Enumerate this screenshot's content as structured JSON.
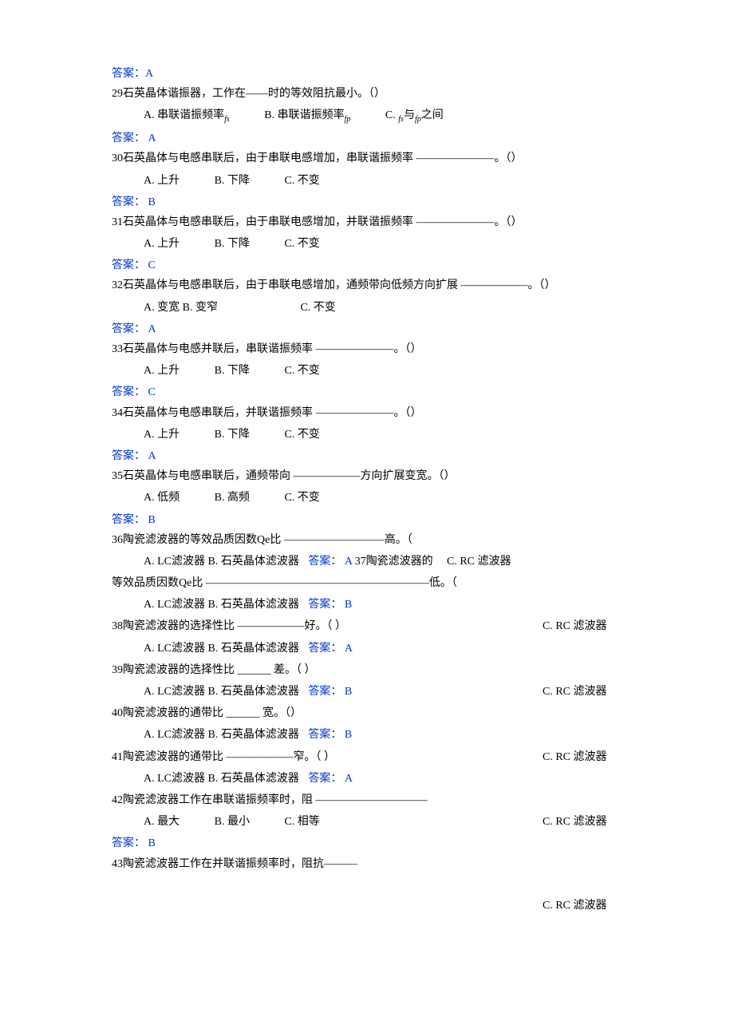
{
  "a28": "答案：A",
  "q29": "29石英晶体谐振器，工作在——时的等效阻抗最小。（）",
  "q29a": "A. 串联谐振频率",
  "q29a_sub": "fs",
  "q29b": "B. 串联谐振频率",
  "q29b_sub": "fp",
  "q29c_pre": "C.  ",
  "q29c_sub1": "fs",
  "q29c_mid": "与",
  "q29c_sub2": "fp",
  "q29c_post": "之间",
  "a29": "答案：  A",
  "q30": "30石英晶体与电感串联后，由于串联电感增加，串联谐振频率 ———————。（）",
  "q30a": "A.  上升",
  "q30b": "B. 下降",
  "q30c": "C. 不变",
  "a30": "答案：  B",
  "q31": "31石英晶体与电感串联后，由于串联电感增加，并联谐振频率 ———————。（）",
  "q31a": "A.  上升",
  "q31b": "B. 下降",
  "q31c": "C. 不变",
  "a31": "答案：  C",
  "q32": "32石英晶体与电感串联后，由于串联电感增加，通频带向低频方向扩展 ——————。（）",
  "q32a": "A. 变宽 B. 变窄",
  "q32c": "C. 不变",
  "a32": "答案：  A",
  "q33": "33石英晶体与电感并联后，串联谐振频率 ———————。（）",
  "q33a": "A.  上升",
  "q33b": "B. 下降",
  "q33c": "C. 不变",
  "a33": "答案：  C",
  "q34": "34石英晶体与电感串联后，并联谐振频率 ———————。（）",
  "q34a": "A.  上升",
  "q34b": "B. 下降",
  "q34c": "C. 不变",
  "a34": "答案：  A",
  "q35": "35石英晶体与电感串联后，通频带向 ——————方向扩展变宽。（）",
  "q35a": "A. 低频",
  "q35b": "B. 高频",
  "q35c": "C. 不变",
  "a35": "答案：  B",
  "q36": "36陶瓷滤波器的等效品质因数Qe比 —————————高。（",
  "q36a": "A.  LC滤波器 B.  石英晶体滤波器",
  "a36": "答案：  A",
  "q37_inline": "37陶瓷滤波器的",
  "q37_overlap": "C.  RC 滤波器",
  "q37_cont": "等效品质因数Qe比 ————————————————————低。（",
  "q37a": "A.  LC滤波器 B.  石英晶体滤波器",
  "a37": "答案：  B",
  "q38": "38陶瓷滤波器的选择性比 ——————好。（ ）",
  "q38c": "C.  RC 滤波器",
  "q38a": "A.  LC滤波器 B.  石英晶体滤波器",
  "a38": "答案：  A",
  "q39": "39陶瓷滤波器的选择性比 ______ 差。（ ）",
  "q39a": "A.  LC滤波器 B.  石英晶体滤波器",
  "a39": "答案：  B",
  "q39c": "C.  RC 滤波器",
  "q40": "40陶瓷滤波器的通带比 ______ 宽。（）",
  "q40a": "A.  LC滤波器 B.  石英晶体滤波器",
  "a40": "答案：  B",
  "q41": "41陶瓷滤波器的通带比 ——————窄。（ ）",
  "q41c": "C.  RC 滤波器",
  "q41a": "A.  LC滤波器 B.  石英晶体滤波器",
  "a41": "答案：  A",
  "q42": "42陶瓷滤波器工作在串联谐振频率时，阻 ——————————",
  "q42a": "A. 最大",
  "q42b": "B. 最小",
  "q42c": "C. 相等",
  "q42rc": "C.  RC 滤波器",
  "a42": "答案：  B",
  "q43": "43陶瓷滤波器工作在并联谐振频率时，阻抗———",
  "q43rc": "C.  RC 滤波器"
}
